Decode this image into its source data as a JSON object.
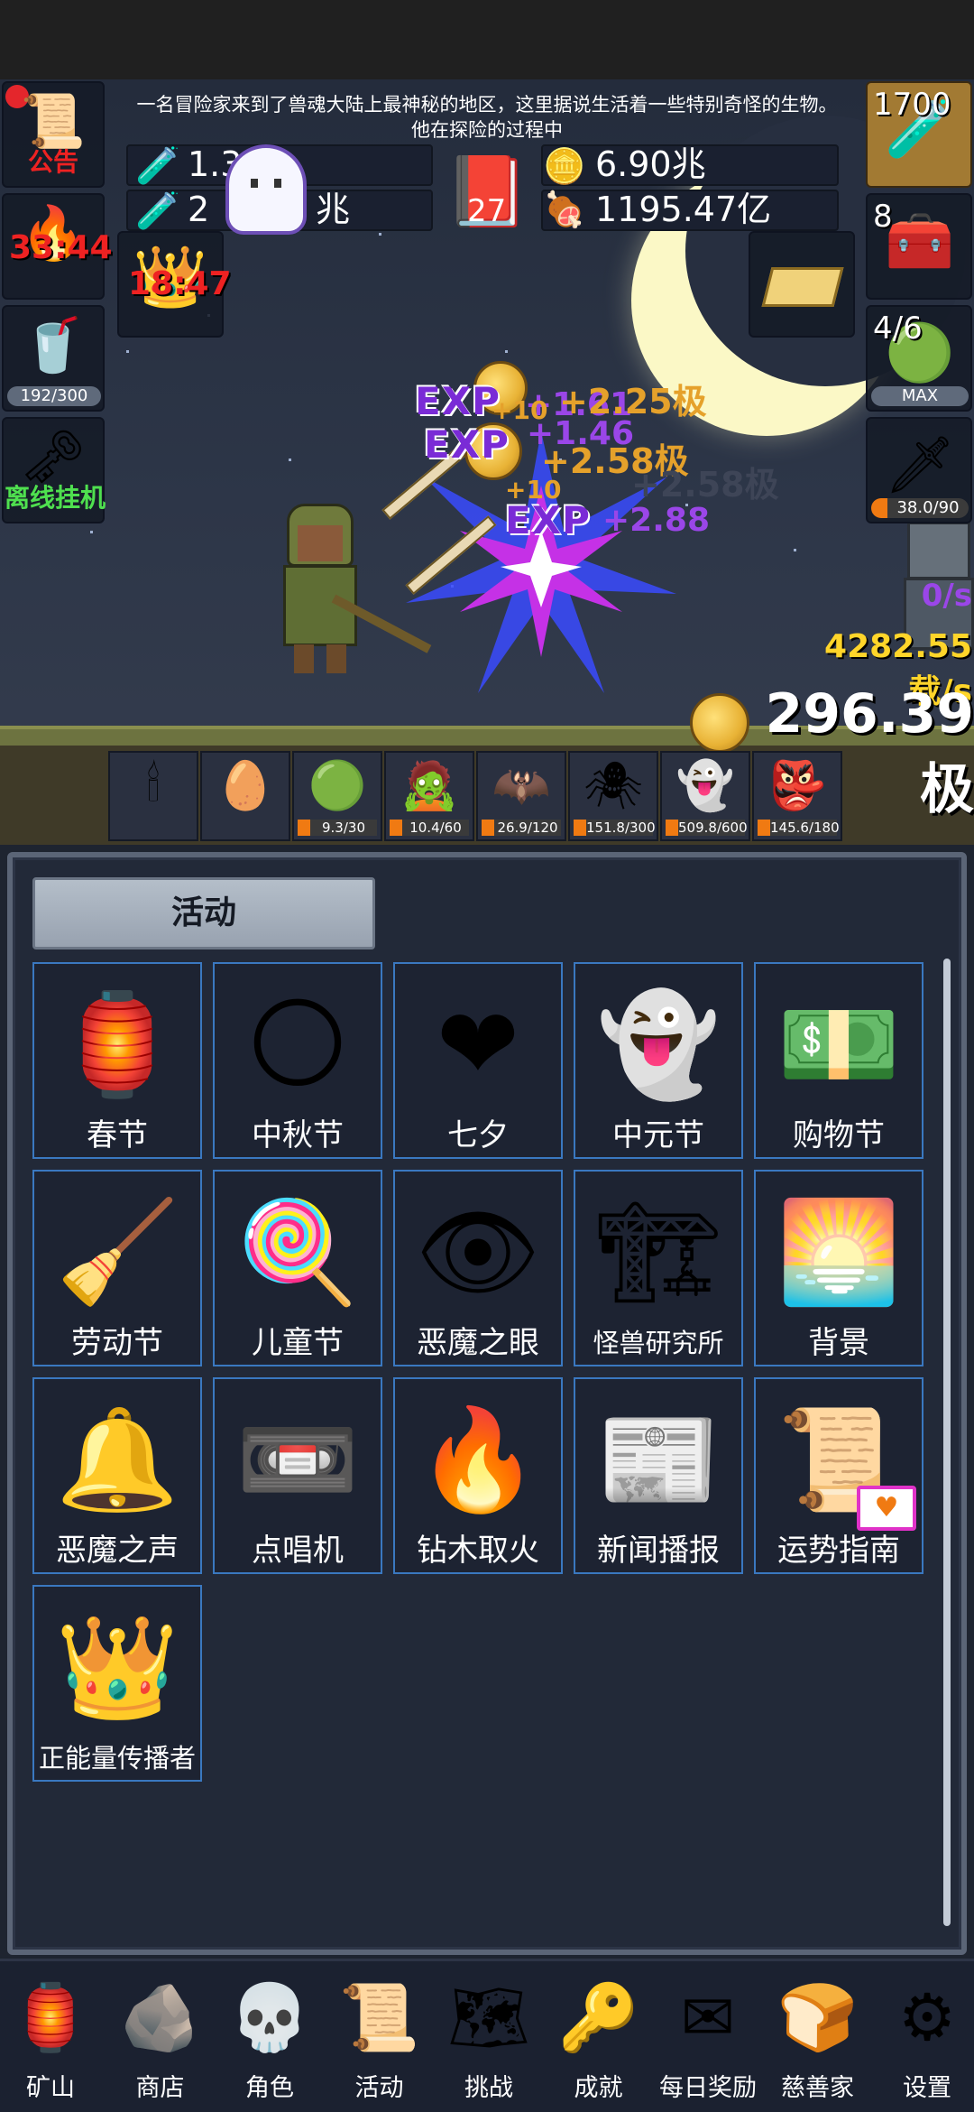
{
  "notice": {
    "line1": "一名冒险家来到了兽魂大陆上最神秘的地区，这里据说生活着一些特别奇怪的生物。",
    "line2": "他在探险的过程中"
  },
  "resources": {
    "potion_blue": "1.3",
    "potion_green": "2",
    "potion_green_unit": "兆",
    "book_count": "27",
    "gold": "6.90兆",
    "meat": "1195.47亿"
  },
  "left_buttons": {
    "announcement": "公告",
    "torch_timer": "33:44",
    "crown_timer": "18:47",
    "drink_progress": "192/300",
    "offline": "离线挂机"
  },
  "right_buttons": {
    "potion_count": "1700",
    "chest_count": "8",
    "slime_count": "4/6",
    "slime_max": "MAX",
    "sword_progress": "38.0/90"
  },
  "floating_text": {
    "exp1": "EXP",
    "exp1_val": "+1.61",
    "exp2": "EXP",
    "exp2_val": "+1.46",
    "exp3": "EXP",
    "exp3_val": "+2.88",
    "gold1": "+2.25极",
    "gold2": "+2.58极",
    "gold3": "+2.58极",
    "ten1": "+10",
    "ten2": "+10"
  },
  "stats": {
    "dps_zero": "0/s",
    "gold_rate": "4282.55载/s",
    "gold_total": "296.39极"
  },
  "monsters": [
    {
      "icon": "candle-icon",
      "glyph": "🕯",
      "hp": ""
    },
    {
      "icon": "egg-icon",
      "glyph": "🥚",
      "hp": ""
    },
    {
      "icon": "slime-icon",
      "glyph": "🟢",
      "hp": "9.3/30"
    },
    {
      "icon": "zombie-icon",
      "glyph": "🧟",
      "hp": "10.4/60"
    },
    {
      "icon": "bat-icon",
      "glyph": "🦇",
      "hp": "26.9/120"
    },
    {
      "icon": "spider-icon",
      "glyph": "🕷",
      "hp": "151.8/300"
    },
    {
      "icon": "ghost-icon",
      "glyph": "👻",
      "hp": "509.8/600"
    },
    {
      "icon": "goblin-icon",
      "glyph": "👺",
      "hp": "145.6/180"
    }
  ],
  "panel": {
    "title": "活动",
    "tiles": [
      {
        "label": "春节",
        "icon": "lantern-icon",
        "glyph": "🏮"
      },
      {
        "label": "中秋节",
        "icon": "moon-icon",
        "glyph": "🌕"
      },
      {
        "label": "七夕",
        "icon": "heart-icon",
        "glyph": "❤"
      },
      {
        "label": "中元节",
        "icon": "ghost-icon",
        "glyph": "👻"
      },
      {
        "label": "购物节",
        "icon": "money-icon",
        "glyph": "💵"
      },
      {
        "label": "劳动节",
        "icon": "brush-icon",
        "glyph": "🧹"
      },
      {
        "label": "儿童节",
        "icon": "lollipop-icon",
        "glyph": "🍭"
      },
      {
        "label": "恶魔之眼",
        "icon": "eye-icon",
        "glyph": "👁"
      },
      {
        "label": "怪兽研究所",
        "icon": "lab-icon",
        "glyph": "🏗"
      },
      {
        "label": "背景",
        "icon": "sunset-icon",
        "glyph": "🌅"
      },
      {
        "label": "恶魔之声",
        "icon": "bell-icon",
        "glyph": "🔔"
      },
      {
        "label": "点唱机",
        "icon": "cassette-icon",
        "glyph": "📼"
      },
      {
        "label": "钻木取火",
        "icon": "fire-stick-icon",
        "glyph": "🔥"
      },
      {
        "label": "新闻播报",
        "icon": "newspaper-icon",
        "glyph": "📰"
      },
      {
        "label": "运势指南",
        "icon": "fortune-card-icon",
        "glyph": "📜"
      },
      {
        "label": "正能量传播者",
        "icon": "crown-icon",
        "glyph": "👑"
      }
    ]
  },
  "nav": [
    {
      "label": "矿山",
      "icon": "lantern-icon",
      "glyph": "🏮"
    },
    {
      "label": "商店",
      "icon": "stone-icon",
      "glyph": "🪨"
    },
    {
      "label": "角色",
      "icon": "skull-icon",
      "glyph": "💀"
    },
    {
      "label": "活动",
      "icon": "scroll-icon",
      "glyph": "📜"
    },
    {
      "label": "挑战",
      "icon": "map-icon",
      "glyph": "🗺"
    },
    {
      "label": "成就",
      "icon": "key-icon",
      "glyph": "🔑"
    },
    {
      "label": "每日奖励",
      "icon": "letter-icon",
      "glyph": "✉"
    },
    {
      "label": "慈善家",
      "icon": "bread-icon",
      "glyph": "🍞"
    },
    {
      "label": "设置",
      "icon": "gear-icon",
      "glyph": "⚙"
    }
  ]
}
